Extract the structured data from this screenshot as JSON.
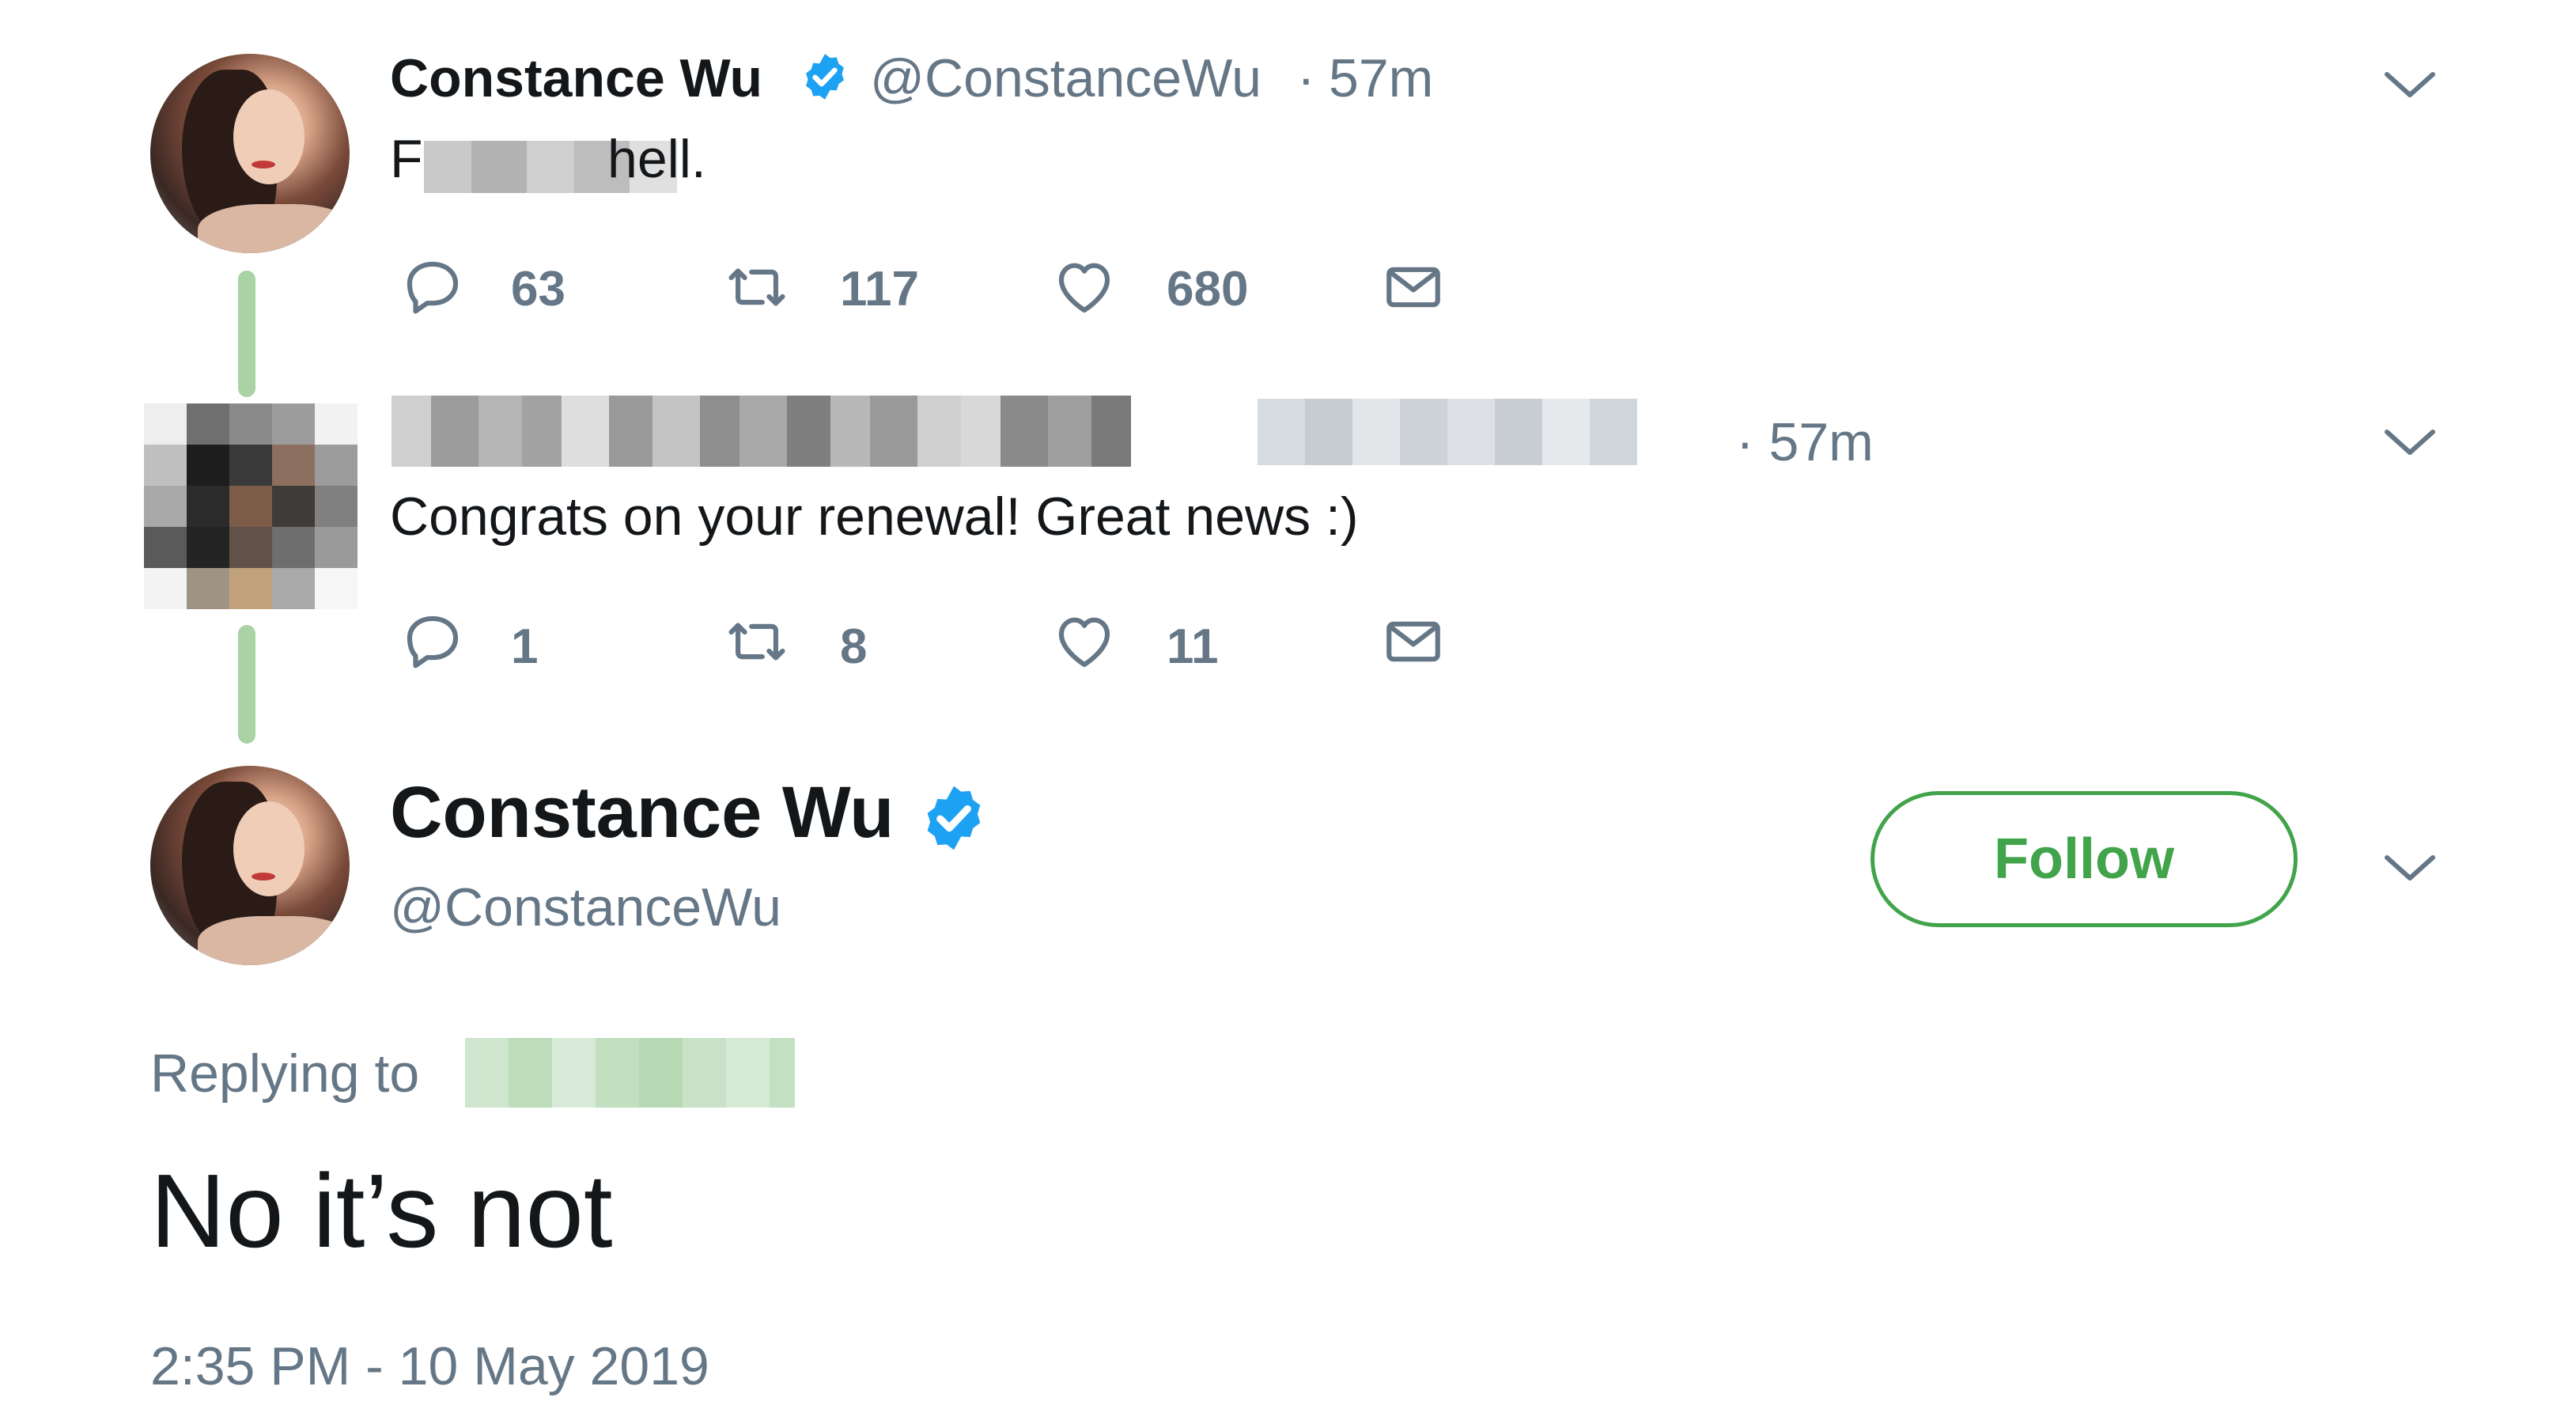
{
  "tweet1": {
    "name": "Constance Wu",
    "handle": "@ConstanceWu",
    "separator": "·",
    "time": "57m",
    "text_start": "F",
    "text_end": "hell.",
    "actions": {
      "reply_count": "63",
      "retweet_count": "117",
      "like_count": "680"
    }
  },
  "tweet2": {
    "time": "· 57m",
    "text": "Congrats on your renewal! Great news :)",
    "actions": {
      "reply_count": "1",
      "retweet_count": "8",
      "like_count": "11"
    }
  },
  "main_tweet": {
    "name": "Constance Wu",
    "handle": "@ConstanceWu",
    "follow_label": "Follow",
    "replying_to_label": "Replying to",
    "text": "No it’s not",
    "timestamp": "2:35 PM - 10 May 2019"
  },
  "icons": {
    "reply": "speech-bubble-icon",
    "retweet": "retweet-arrows-icon",
    "like": "heart-icon",
    "dm": "envelope-icon",
    "verified": "verified-badge-icon",
    "menu": "chevron-down-icon"
  },
  "colors": {
    "verified_blue": "#1da1f2",
    "follow_green": "#41a34a",
    "thread_line": "#a9d3a5",
    "muted_text": "#657786",
    "primary_text": "#14171a"
  }
}
